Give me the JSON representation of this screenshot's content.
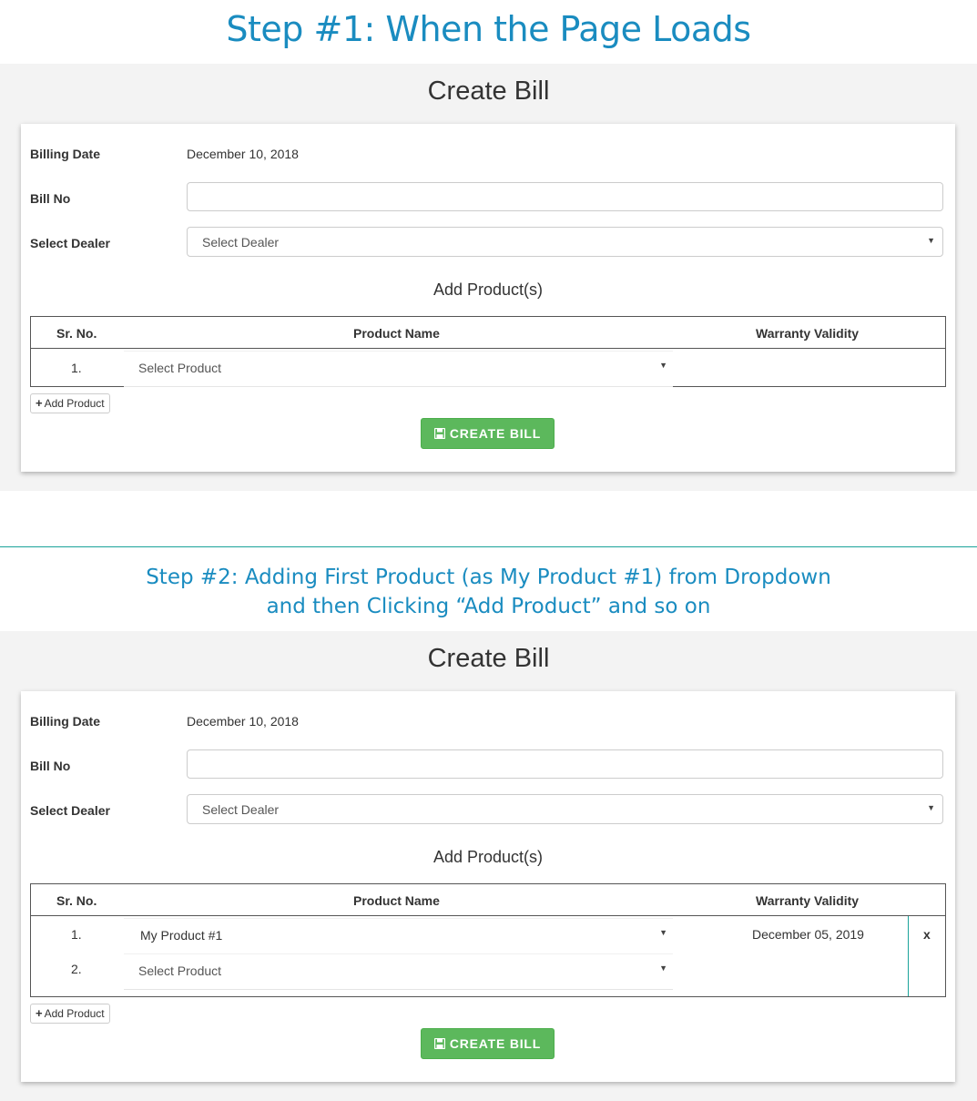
{
  "step1": {
    "title": "Step #1: When the Page Loads"
  },
  "step2": {
    "title_line1": "Step #2: Adding First Product (as My Product #1) from Dropdown",
    "title_line2": "and then Clicking “Add Product” and so on"
  },
  "form": {
    "heading": "Create Bill",
    "billing_date_label": "Billing Date",
    "billing_date_value": "December 10, 2018",
    "bill_no_label": "Bill No",
    "bill_no_value": "",
    "dealer_label": "Select Dealer",
    "dealer_selected": "Select Dealer",
    "products_heading": "Add Product(s)",
    "columns": [
      "Sr. No.",
      "Product Name",
      "Warranty Validity"
    ],
    "add_product_label": "Add Product",
    "create_bill_label": "CREATE BILL"
  },
  "step1_rows": [
    {
      "sr": "1.",
      "product": "Select Product",
      "warranty": ""
    }
  ],
  "step2_rows": [
    {
      "sr": "1.",
      "product": "My Product #1",
      "warranty": "December 05, 2019",
      "remove": "x"
    },
    {
      "sr": "2.",
      "product": "Select Product",
      "warranty": ""
    }
  ],
  "colors": {
    "accent_blue": "#1a8cc0",
    "success_green": "#5cb85c",
    "teal_divider": "#1aa39a"
  }
}
